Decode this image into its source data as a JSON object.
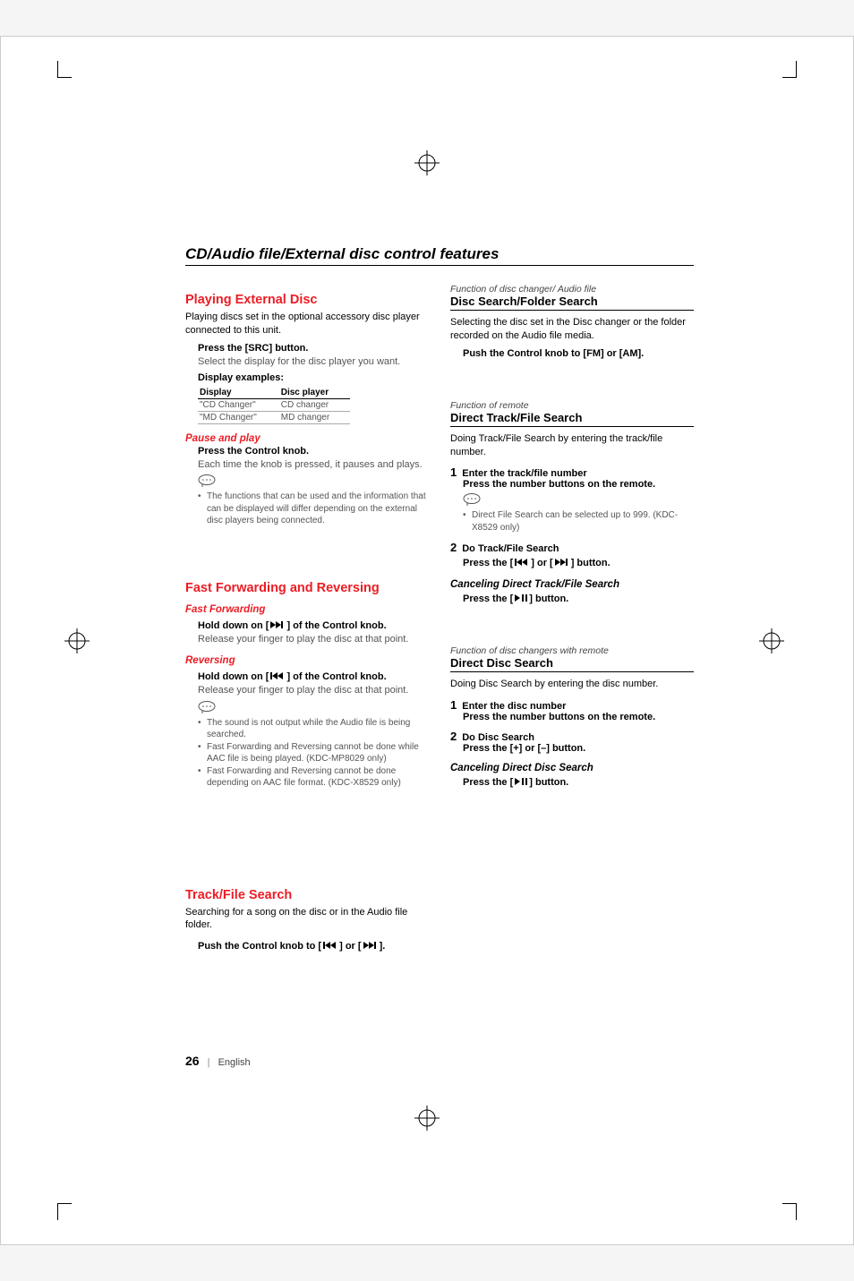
{
  "page": {
    "number": "26",
    "language": "English",
    "heading": "CD/Audio file/External disc control features"
  },
  "left": {
    "playing": {
      "title": "Playing External Disc",
      "intro": "Playing discs set in the optional accessory disc player connected to this unit.",
      "press_src": "Press the [SRC] button.",
      "select_display": "Select the display for the disc player you want.",
      "display_examples": "Display examples:",
      "table": {
        "h1": "Display",
        "h2": "Disc player",
        "r1c1": "\"CD Changer\"",
        "r1c2": "CD changer",
        "r2c1": "\"MD Changer\"",
        "r2c2": "MD changer"
      },
      "pause_title": "Pause and play",
      "pause_press": "Press the Control knob.",
      "pause_text": "Each time the knob is pressed, it pauses and plays.",
      "note1": "The functions that can be used and the information that can be displayed will differ depending on the external disc players being connected."
    },
    "ffrw": {
      "title": "Fast Forwarding and Reversing",
      "ff_title": "Fast Forwarding",
      "ff_hold_pre": "Hold down on [",
      "ff_hold_post": "] of the Control knob.",
      "ff_release": "Release your finger to play the disc at that point.",
      "rev_title": "Reversing",
      "rev_hold_pre": "Hold down on [",
      "rev_hold_post": "] of the Control knob.",
      "rev_release": "Release your finger to play the disc at that point.",
      "note1": "The sound is not output while the Audio file is being searched.",
      "note2": "Fast Forwarding and Reversing cannot be done while AAC file is being played. (KDC-MP8029 only)",
      "note3": "Fast Forwarding and Reversing cannot be done depending on AAC file format. (KDC-X8529 only)"
    },
    "trackfile": {
      "title": "Track/File Search",
      "intro": "Searching for a song on the disc or in the Audio file folder.",
      "push_pre": "Push the Control knob to [",
      "push_mid": "] or [",
      "push_post": "]."
    }
  },
  "right": {
    "discfolder": {
      "func": "Function of disc changer/ Audio file",
      "title": "Disc Search/Folder Search",
      "intro": "Selecting the disc set in the Disc changer or the folder recorded on the Audio file media.",
      "push": "Push the Control knob to [FM] or [AM]."
    },
    "directtrack": {
      "func": "Function of remote",
      "title": "Direct Track/File Search",
      "intro": "Doing Track/File Search by entering the track/file number.",
      "step1": "Enter the track/file number",
      "step1_sub": "Press the number buttons on the remote.",
      "note1": "Direct File Search can be selected up to 999. (KDC-X8529 only)",
      "step2": "Do Track/File Search",
      "step2_press_pre": "Press the [",
      "step2_press_mid": "] or [",
      "step2_press_post": "] button.",
      "cancel_title": "Canceling Direct Track/File Search",
      "cancel_press_pre": "Press the [",
      "cancel_press_post": "] button."
    },
    "directdisc": {
      "func": "Function of disc changers with remote",
      "title": "Direct Disc Search",
      "intro": "Doing Disc Search by entering the disc number.",
      "step1": "Enter the disc number",
      "step1_sub": "Press the number buttons on the remote.",
      "step2": "Do Disc Search",
      "step2_sub": "Press the [+] or [–] button.",
      "cancel_title": "Canceling Direct Disc Search",
      "cancel_press_pre": "Press the [",
      "cancel_press_post": "] button."
    }
  }
}
